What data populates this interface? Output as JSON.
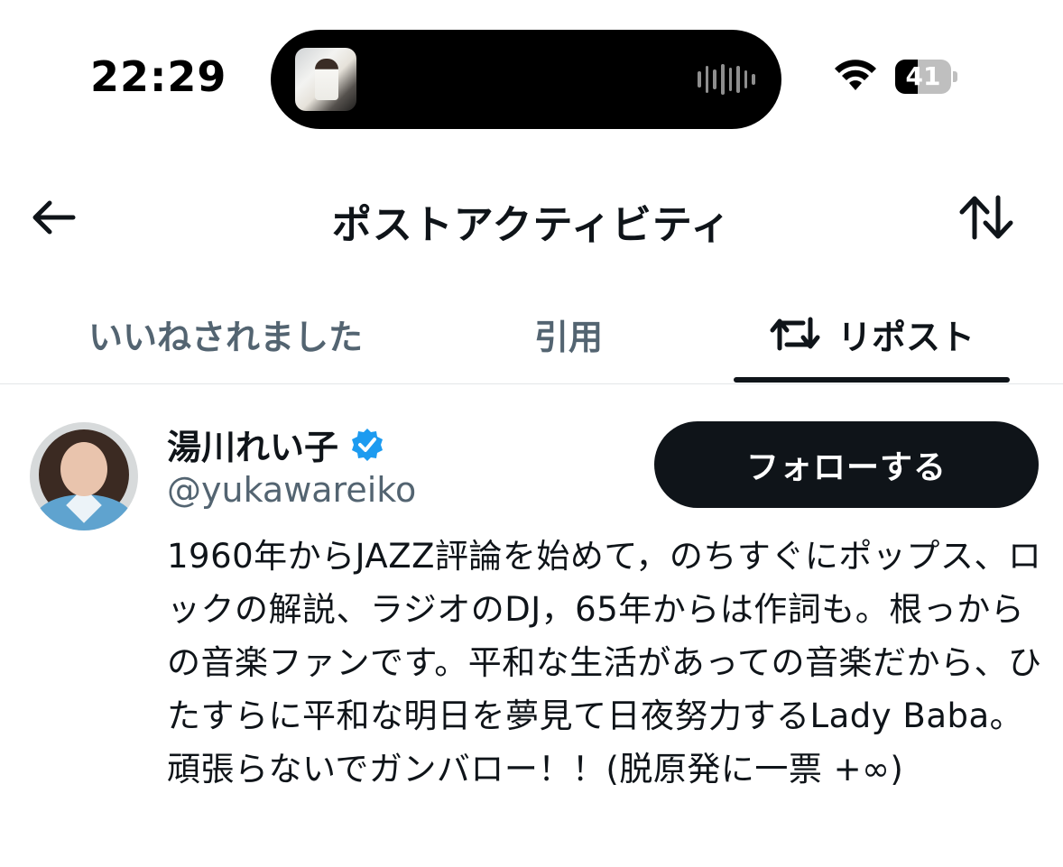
{
  "status_bar": {
    "time": "22:29",
    "battery_level": "41",
    "battery_fraction": 0.41,
    "icons": [
      "album-art-icon",
      "waveform-icon",
      "wifi-icon",
      "battery-icon"
    ]
  },
  "header": {
    "title": "ポストアクティビティ",
    "back_icon": "arrow-left-icon",
    "sort_icon": "sort-arrows-icon"
  },
  "tabs": [
    {
      "label": "いいねされました",
      "active": false
    },
    {
      "label": "引用",
      "active": false
    },
    {
      "label": "リポスト",
      "active": true,
      "icon": "repost-icon"
    }
  ],
  "user": {
    "display_name": "湯川れい子",
    "verified": true,
    "handle": "@yukawareiko",
    "follow_label": "フォローする",
    "bio": "1960年からJAZZ評論を始めて，のちすぐにポップス、ロックの解説、ラジオのDJ，65年からは作詞も。根っからの音楽ファンです。平和な生活があっての音楽だから、ひたすらに平和な明日を夢見て日夜努力するLady Baba。頑張らないでガンバロー！！(脱原発に一票 +∞)"
  },
  "colors": {
    "text_primary": "#0f1419",
    "text_secondary": "#536471",
    "verified_blue": "#1d9bf0",
    "button_bg": "#0f1419"
  }
}
